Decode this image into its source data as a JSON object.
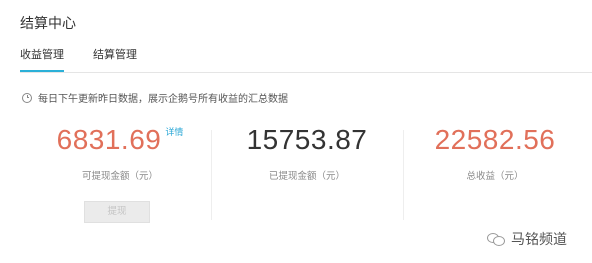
{
  "header": {
    "title": "结算中心"
  },
  "tabs": [
    {
      "label": "收益管理",
      "active": true
    },
    {
      "label": "结算管理",
      "active": false
    }
  ],
  "notice": {
    "text": "每日下午更新昨日数据，展示企鹅号所有收益的汇总数据",
    "icon": "clock-icon"
  },
  "stats": [
    {
      "amount": "6831.69",
      "label": "可提现金额（元）",
      "link": "详情",
      "color": "#e1705a"
    },
    {
      "amount": "15753.87",
      "label": "已提现金额（元）",
      "color": "#333333"
    },
    {
      "amount": "22582.56",
      "label": "总收益（元）",
      "color": "#e1705a"
    }
  ],
  "withdraw_button": {
    "label": "提现",
    "disabled": true
  },
  "watermark": {
    "text": "马铭频道",
    "icon": "wechat-icon"
  },
  "colors": {
    "accent": "#2bb0d8",
    "amount_highlight": "#e1705a",
    "link": "#2aa7d6"
  }
}
